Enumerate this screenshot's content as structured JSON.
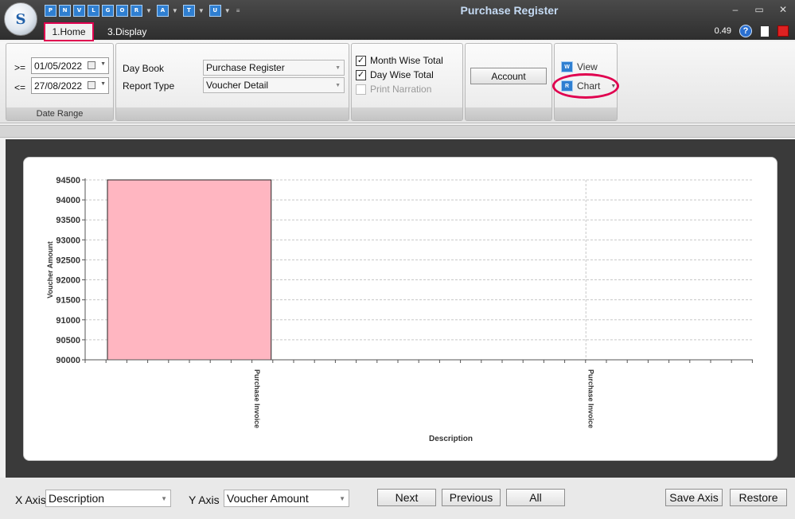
{
  "window": {
    "title": "Purchase Register",
    "version": "0.49"
  },
  "quick_access": [
    "P",
    "N",
    "V",
    "L",
    "G",
    "O",
    "R",
    "A",
    "T",
    "U"
  ],
  "tabs": [
    {
      "label": "1.Home",
      "active": true
    },
    {
      "label": "3.Display",
      "active": false
    }
  ],
  "date_range": {
    "from_op": ">=",
    "from": "01/05/2022",
    "to_op": "<=",
    "to": "27/08/2022",
    "caption": "Date Range"
  },
  "report": {
    "day_book_label": "Day Book",
    "day_book_value": "Purchase Register",
    "report_type_label": "Report Type",
    "report_type_value": "Voucher Detail"
  },
  "options": {
    "month_wise_total": {
      "label": "Month Wise Total",
      "checked": true
    },
    "day_wise_total": {
      "label": "Day Wise Total",
      "checked": true
    },
    "print_narration": {
      "label": "Print Narration",
      "checked": false
    }
  },
  "account_button": "Account",
  "view_group": {
    "view_label": "View",
    "chart_label": "Chart"
  },
  "chart_data": {
    "type": "bar",
    "categories": [
      "Purchase Invoice",
      "Purchase Invoice"
    ],
    "values": [
      94500,
      90000
    ],
    "xlabel": "Description",
    "ylabel": "Voucher Amount",
    "ylim": [
      90000,
      94500
    ],
    "yticks": [
      90000,
      90500,
      91000,
      91500,
      92000,
      92500,
      93000,
      93500,
      94000,
      94500
    ],
    "grid": true,
    "bar_color": "#ffb6c1"
  },
  "bottom": {
    "x_axis_label": "X Axis",
    "x_axis_value": "Description",
    "y_axis_label": "Y Axis",
    "y_axis_value": "Voucher Amount",
    "next": "Next",
    "previous": "Previous",
    "all": "All",
    "save_axis": "Save Axis",
    "restore": "Restore"
  }
}
